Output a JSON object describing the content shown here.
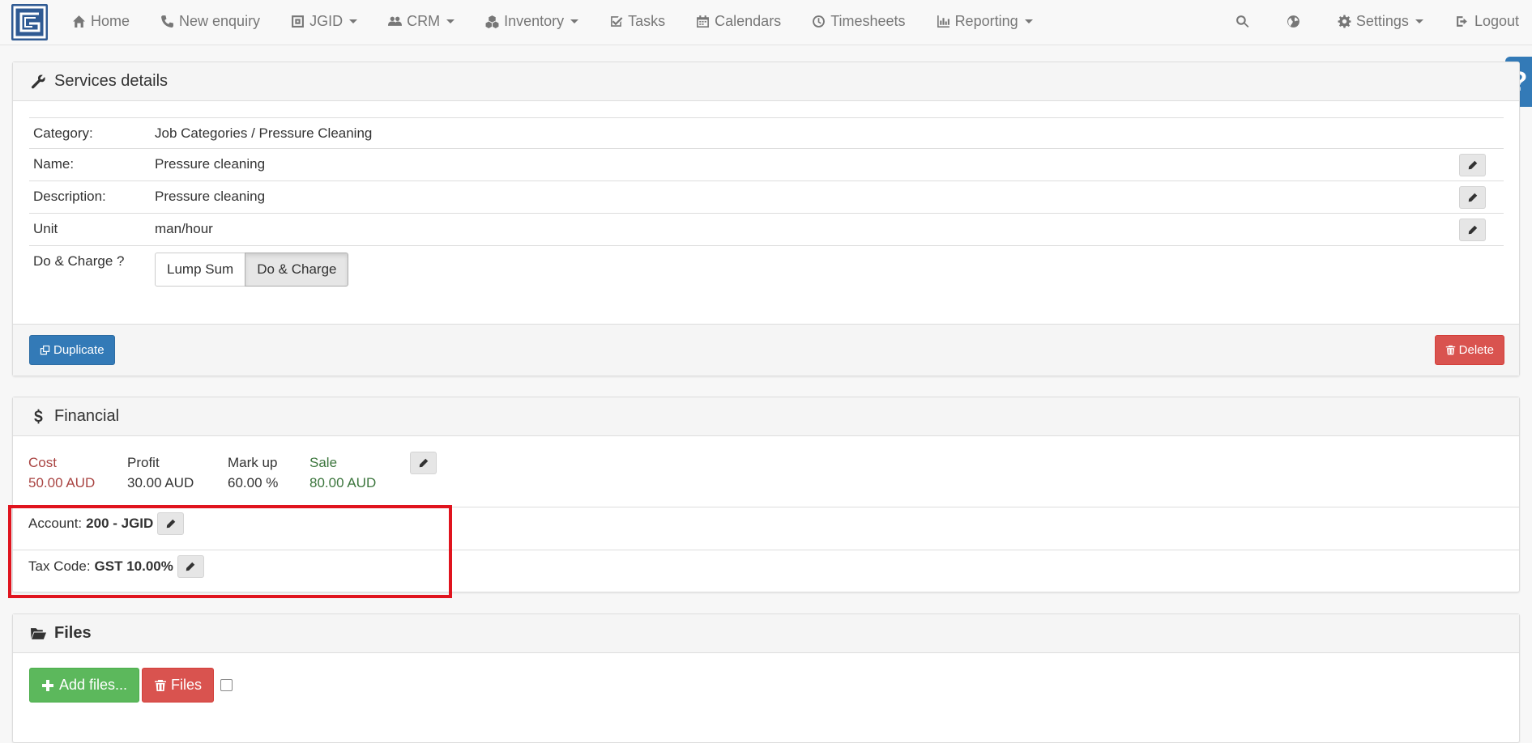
{
  "nav": {
    "left": [
      {
        "label": "Home",
        "icon": "home-icon"
      },
      {
        "label": "New enquiry",
        "icon": "phone-icon"
      },
      {
        "label": "JGID",
        "icon": "company-icon"
      },
      {
        "label": "CRM",
        "icon": "users-icon"
      },
      {
        "label": "Inventory",
        "icon": "cubes-icon"
      },
      {
        "label": "Tasks",
        "icon": "check-square-icon"
      },
      {
        "label": "Calendars",
        "icon": "calendar-icon"
      },
      {
        "label": "Timesheets",
        "icon": "clock-icon"
      },
      {
        "label": "Reporting",
        "icon": "bar-chart-icon"
      }
    ],
    "settings": "Settings",
    "logout": "Logout"
  },
  "help": "?",
  "services": {
    "title": "Services details",
    "category_label": "Category:",
    "category_value": "Job Categories / Pressure Cleaning",
    "name_label": "Name:",
    "name_value": "Pressure cleaning",
    "description_label": "Description:",
    "description_value": "Pressure cleaning",
    "unit_label": "Unit",
    "unit_value": "man/hour",
    "do_charge_label": "Do & Charge ?",
    "option_lump_sum": "Lump Sum",
    "option_do_charge": "Do & Charge",
    "selected_option": "Do & Charge",
    "duplicate": "Duplicate",
    "delete": "Delete"
  },
  "financial": {
    "title": "Financial",
    "cost_label": "Cost",
    "cost_value": "50.00 AUD",
    "profit_label": "Profit",
    "profit_value": "30.00 AUD",
    "markup_label": "Mark up",
    "markup_value": "60.00 %",
    "sale_label": "Sale",
    "sale_value": "80.00 AUD",
    "account_label": "Account:",
    "account_value": "200 - JGID",
    "tax_label": "Tax Code:",
    "tax_value": "GST 10.00%"
  },
  "files": {
    "title": "Files",
    "add_files": "Add files...",
    "delete_files": "Files"
  },
  "colors": {
    "primary": "#337ab7",
    "danger": "#d9534f",
    "success": "#5cb85c",
    "highlight_box": "#e0141e",
    "cost_red": "#a94442",
    "sale_green": "#3c763d"
  }
}
